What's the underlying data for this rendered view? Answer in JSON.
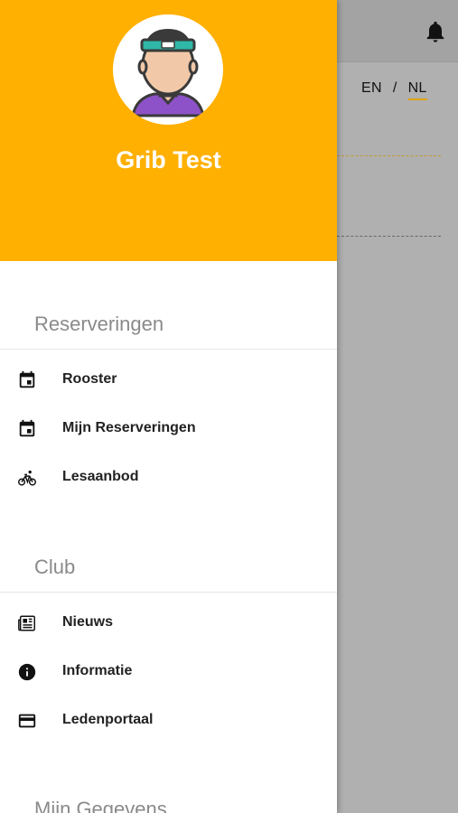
{
  "header": {
    "user_name": "Grib Test"
  },
  "language": {
    "option_en": "EN",
    "separator": "/",
    "option_nl": "NL",
    "active": "NL"
  },
  "sections": {
    "reserveringen": {
      "title": "Reserveringen",
      "items": [
        {
          "label": "Rooster",
          "icon": "calendar-icon"
        },
        {
          "label": "Mijn Reserveringen",
          "icon": "calendar-icon"
        },
        {
          "label": "Lesaanbod",
          "icon": "bicycle-icon"
        }
      ]
    },
    "club": {
      "title": "Club",
      "items": [
        {
          "label": "Nieuws",
          "icon": "newspaper-icon"
        },
        {
          "label": "Informatie",
          "icon": "info-icon"
        },
        {
          "label": "Ledenportaal",
          "icon": "credit-card-icon"
        }
      ]
    },
    "mijn_gegevens": {
      "title": "Mijn Gegevens"
    }
  },
  "colors": {
    "accent": "#ffb000",
    "overlay": "#b0b0b0",
    "section_title": "#8a8a8a"
  }
}
